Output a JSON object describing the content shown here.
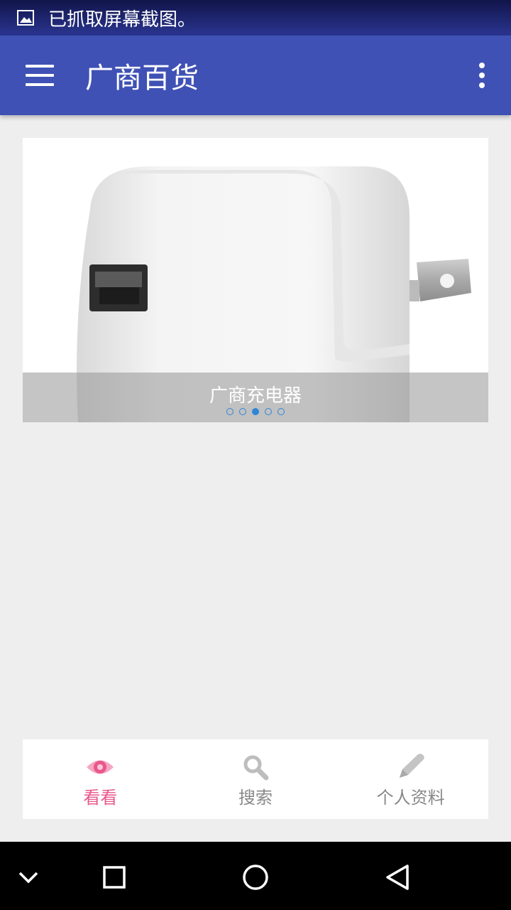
{
  "status_bar": {
    "notification_icon": "image-icon",
    "text": "已抓取屏幕截图。"
  },
  "app_bar": {
    "menu_icon": "hamburger-menu-icon",
    "title": "广商百货",
    "overflow_icon": "more-vertical-icon",
    "color": "#3f51b5"
  },
  "banner": {
    "caption": "广商充电器",
    "image": "usb-charger-image",
    "slide_count": 5,
    "active_slide_index": 2
  },
  "bottom_nav": {
    "items": [
      {
        "label": "看看",
        "icon": "eye-icon",
        "active": true
      },
      {
        "label": "搜索",
        "icon": "search-icon",
        "active": false
      },
      {
        "label": "个人资料",
        "icon": "pencil-icon",
        "active": false
      }
    ],
    "active_color": "#e8578b",
    "inactive_color": "#888888"
  },
  "system_nav": {
    "icons": [
      "chevron-down-icon",
      "recents-square-icon",
      "home-circle-icon",
      "back-triangle-icon"
    ]
  }
}
